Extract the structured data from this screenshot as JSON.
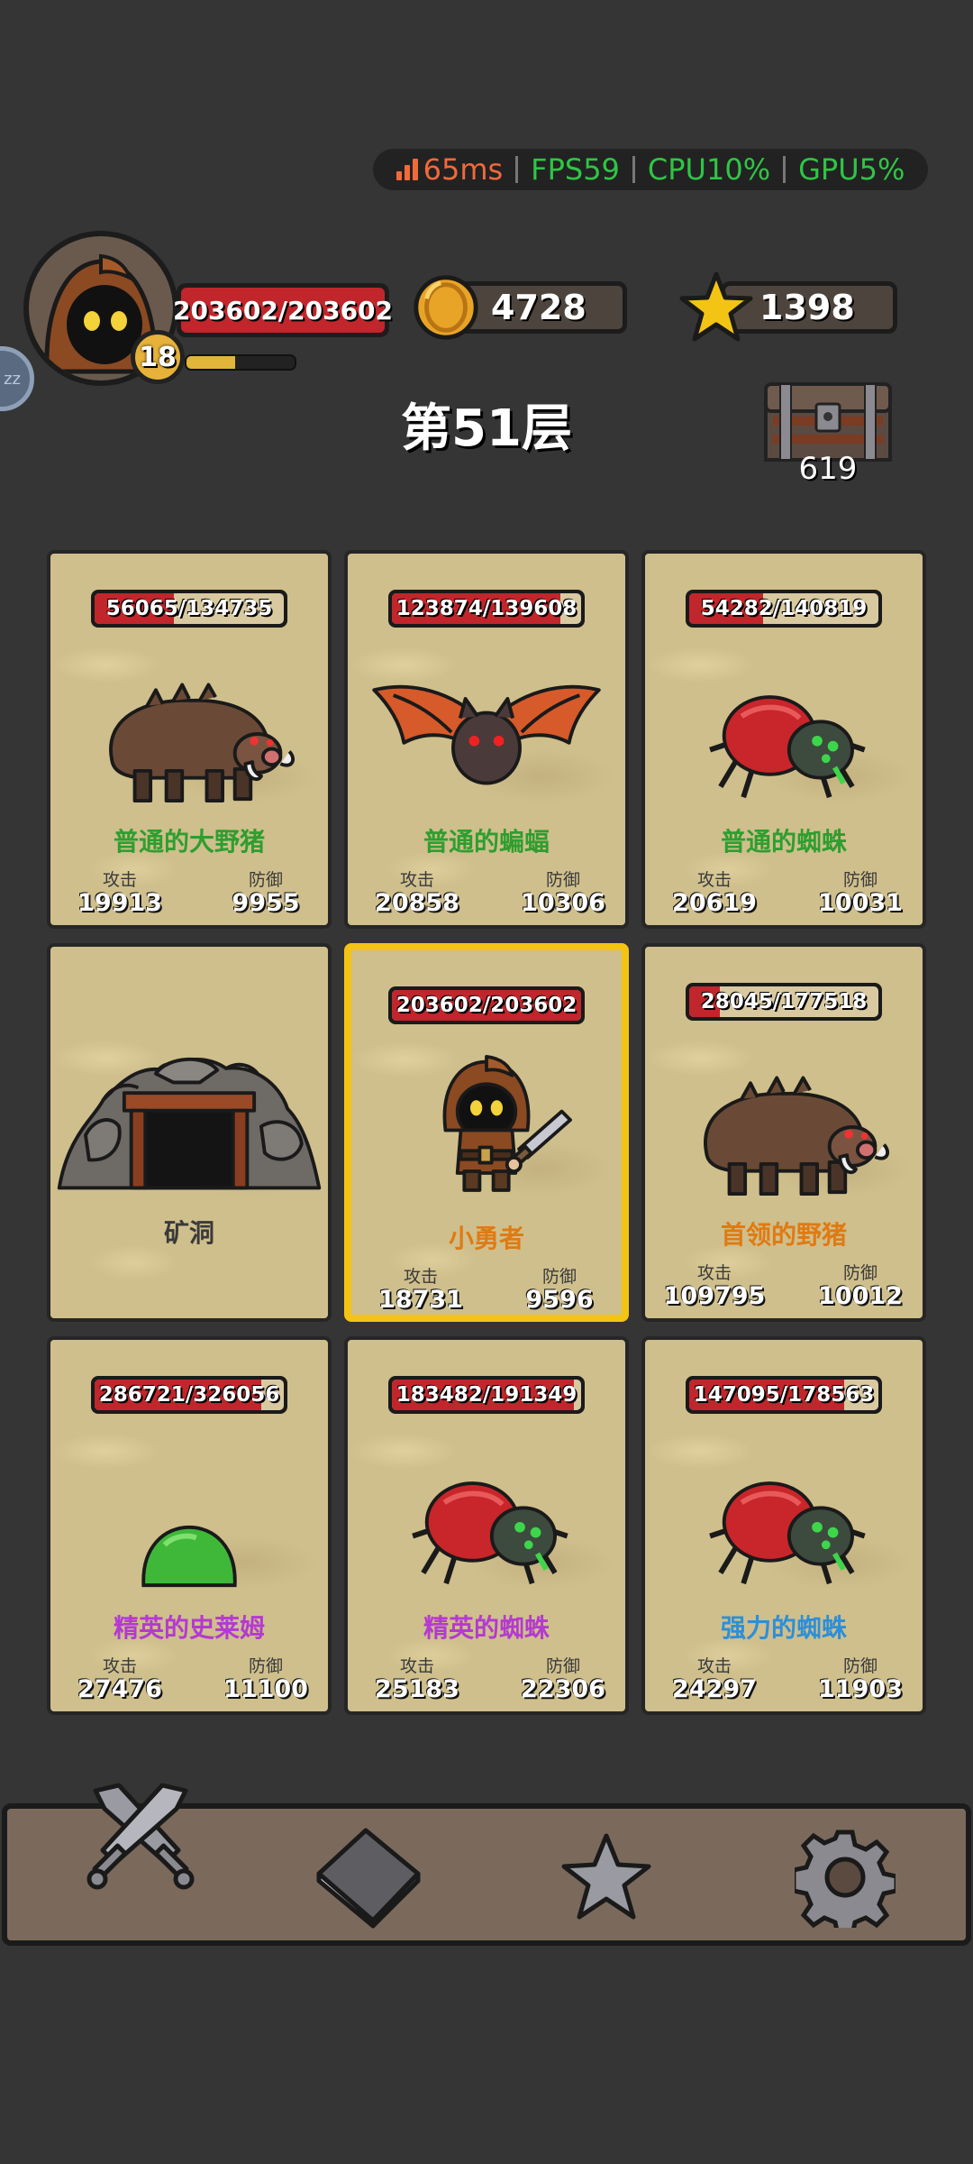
{
  "perf": {
    "ping": "65ms",
    "fps": "FPS59",
    "cpu": "CPU10%",
    "gpu": "GPU5%"
  },
  "player": {
    "hp": "203602/203602",
    "level": "18",
    "xp_fraction": 0.45
  },
  "resources": {
    "coins": "4728",
    "stars": "1398"
  },
  "side_tab": {
    "label": "zz"
  },
  "floor": {
    "title": "第51层"
  },
  "chest": {
    "count": "619"
  },
  "stat_labels": {
    "attack": "攻击",
    "defense": "防御"
  },
  "cards": [
    {
      "type": "monster",
      "sprite": "boar-icon",
      "hp": "56065/134735",
      "hp_fraction": 0.42,
      "name": "普通的大野猪",
      "name_color": "green",
      "atk": "19913",
      "def": "9955"
    },
    {
      "type": "monster",
      "sprite": "bat-icon",
      "hp": "123874/139608",
      "hp_fraction": 0.89,
      "name": "普通的蝙蝠",
      "name_color": "green",
      "atk": "20858",
      "def": "10306"
    },
    {
      "type": "monster",
      "sprite": "spider-icon",
      "hp": "54282/140819",
      "hp_fraction": 0.39,
      "name": "普通的蜘蛛",
      "name_color": "green",
      "atk": "20619",
      "def": "10031"
    },
    {
      "type": "cave",
      "sprite": "mine-entrance-icon",
      "name": "矿洞"
    },
    {
      "type": "hero",
      "sprite": "hero-icon",
      "hp": "203602/203602",
      "hp_fraction": 1.0,
      "name": "小勇者",
      "name_color": "orange",
      "atk": "18731",
      "def": "9596"
    },
    {
      "type": "monster",
      "sprite": "boar-icon",
      "hp": "28045/177518",
      "hp_fraction": 0.16,
      "name": "首领的野猪",
      "name_color": "orange",
      "atk": "109795",
      "def": "10012"
    },
    {
      "type": "monster",
      "sprite": "slime-icon",
      "hp": "286721/326056",
      "hp_fraction": 0.88,
      "name": "精英的史莱姆",
      "name_color": "purple",
      "atk": "27476",
      "def": "11100"
    },
    {
      "type": "monster",
      "sprite": "spider-icon",
      "hp": "183482/191349",
      "hp_fraction": 0.96,
      "name": "精英的蜘蛛",
      "name_color": "purple",
      "atk": "25183",
      "def": "22306"
    },
    {
      "type": "monster",
      "sprite": "spider-icon",
      "hp": "147095/178563",
      "hp_fraction": 0.82,
      "name": "强力的蜘蛛",
      "name_color": "blue",
      "atk": "24297",
      "def": "11903"
    }
  ],
  "nav": [
    {
      "icon": "crossed-swords-icon"
    },
    {
      "icon": "book-icon"
    },
    {
      "icon": "star-icon"
    },
    {
      "icon": "gear-icon"
    }
  ]
}
